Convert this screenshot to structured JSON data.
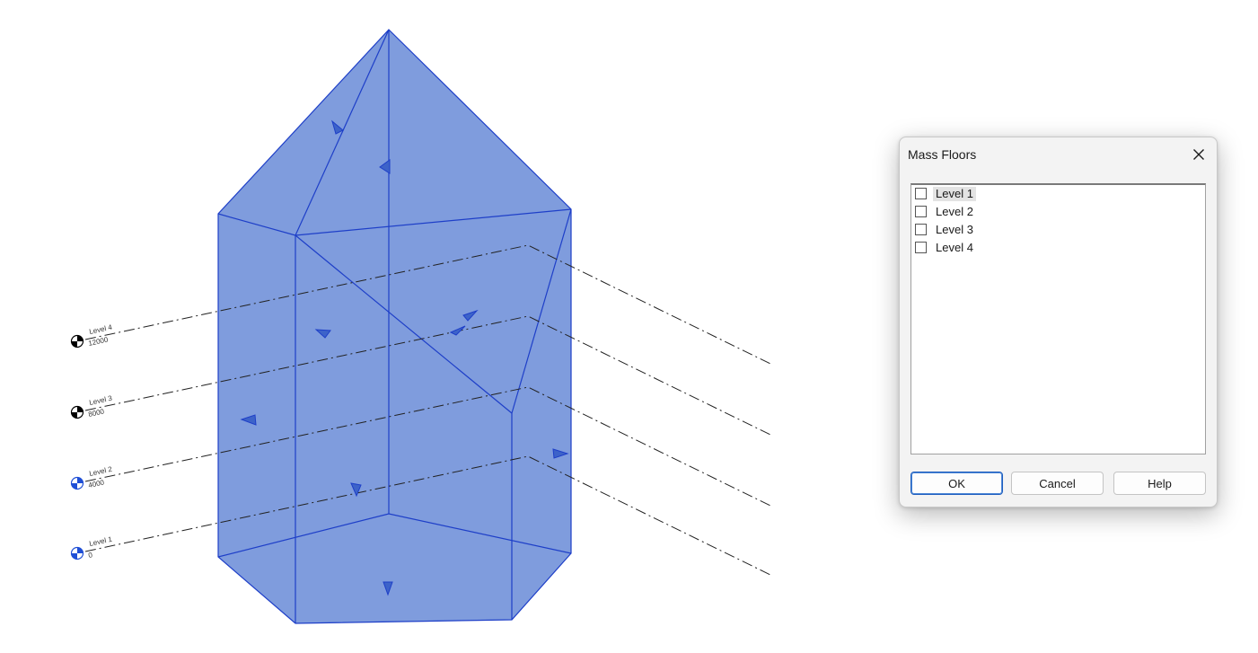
{
  "viewport": {
    "levels": [
      {
        "name": "Level 4",
        "elevation": "12000",
        "marker_color": "#000000"
      },
      {
        "name": "Level 3",
        "elevation": "8000",
        "marker_color": "#000000"
      },
      {
        "name": "Level 2",
        "elevation": "4000",
        "marker_color": "#1f4fd6"
      },
      {
        "name": "Level 1",
        "elevation": "0",
        "marker_color": "#1f4fd6"
      }
    ],
    "mass_fill_color": "#7f9cdd",
    "mass_edge_color": "#1e3fc8"
  },
  "dialog": {
    "title": "Mass Floors",
    "close_icon": "close-icon",
    "levels": [
      {
        "label": "Level 1",
        "checked": false,
        "selected": true
      },
      {
        "label": "Level 2",
        "checked": false,
        "selected": false
      },
      {
        "label": "Level 3",
        "checked": false,
        "selected": false
      },
      {
        "label": "Level 4",
        "checked": false,
        "selected": false
      }
    ],
    "buttons": {
      "ok": "OK",
      "cancel": "Cancel",
      "help": "Help"
    }
  }
}
